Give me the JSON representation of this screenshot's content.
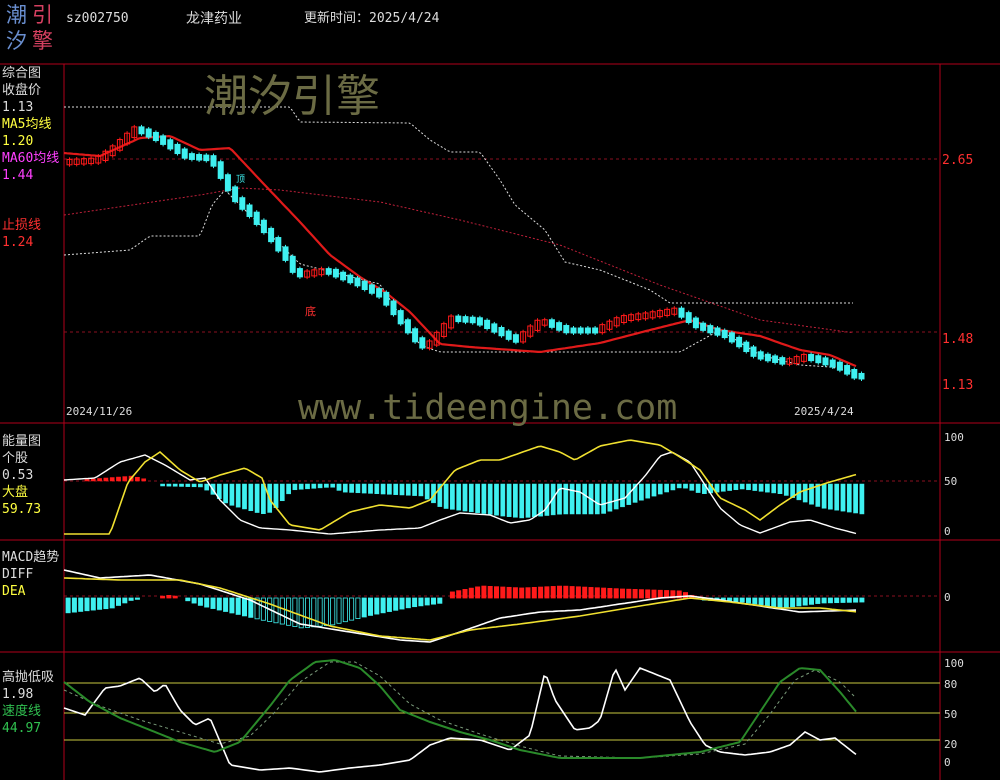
{
  "header": {
    "logo_chars": [
      "潮",
      "引",
      "汐",
      "擎"
    ],
    "code": "sz002750",
    "name": "龙津药业",
    "update_label": "更新时间：",
    "update_date": "2025/4/24"
  },
  "watermarks": {
    "brand": "潮汐引擎",
    "url": "www.tideengine.com"
  },
  "panels": {
    "price": {
      "title": "综合图",
      "close_label": "收盘价",
      "close_value": "1.13",
      "ma5_label": "MA5均线",
      "ma5_value": "1.20",
      "ma60_label": "MA60均线",
      "ma60_value": "1.44",
      "stop_label": "止损线",
      "stop_value": "1.24",
      "axis_labels": [
        "2.65",
        "1.48",
        "1.13"
      ],
      "start_date": "2024/11/26",
      "end_date": "2025/4/24",
      "annotation_bottom": "底",
      "annotation_small": "顶"
    },
    "energy": {
      "title": "能量图",
      "stock_label": "个股",
      "stock_value": "0.53",
      "market_label": "大盘",
      "market_value": "59.73",
      "axis_labels": [
        "100",
        "50",
        "0"
      ]
    },
    "macd": {
      "title": "MACD趋势",
      "diff_label": "DIFF",
      "dea_label": "DEA",
      "axis_labels": [
        "0"
      ]
    },
    "highlow": {
      "title": "高抛低吸",
      "value": "1.98",
      "speed_label": "速度线",
      "speed_value": "44.97",
      "axis_labels": [
        "100",
        "80",
        "50",
        "20",
        "0"
      ]
    }
  },
  "colors": {
    "frame": "#b0001a",
    "bull": "#ff1a1a",
    "bear": "#3ff0f0",
    "ma5": "#e01a1a",
    "ma60": "#c0203a",
    "yellow": "#f0e030",
    "white": "#ffffff",
    "green": "#2a8a2a",
    "label_red": "#ff3030",
    "label_magenta": "#ff40ff",
    "label_yellow": "#ffff40",
    "label_cyan": "#3ff0f0",
    "label_green": "#30c050"
  },
  "chart_data": {
    "type": "line",
    "title": "",
    "series": []
  }
}
